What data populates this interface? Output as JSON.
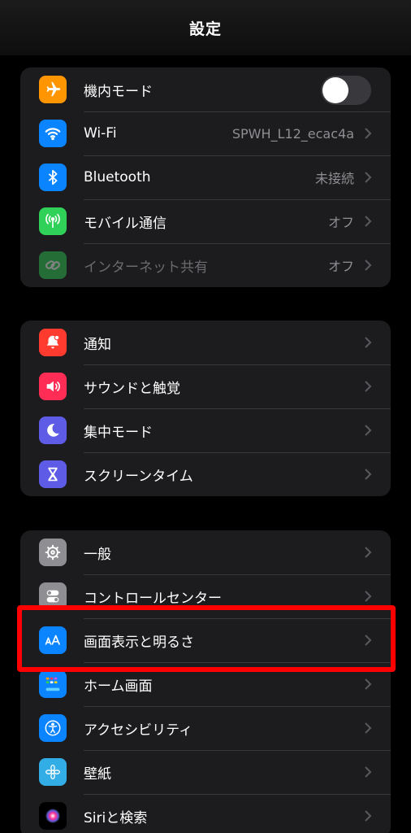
{
  "nav": {
    "title": "設定"
  },
  "groups": [
    {
      "items": [
        {
          "label": "機内モード",
          "icon": "airplane-icon",
          "color": "#ff9500",
          "toggle": false
        },
        {
          "label": "Wi-Fi",
          "value": "SPWH_L12_ecac4a",
          "icon": "wifi-icon",
          "color": "#0a84ff"
        },
        {
          "label": "Bluetooth",
          "value": "未接続",
          "icon": "bluetooth-icon",
          "color": "#0a84ff"
        },
        {
          "label": "モバイル通信",
          "value": "オフ",
          "icon": "antenna-icon",
          "color": "#30d158"
        },
        {
          "label": "インターネット共有",
          "value": "オフ",
          "icon": "link-chain-icon",
          "color": "#30d158"
        }
      ]
    },
    {
      "items": [
        {
          "label": "通知",
          "icon": "bell-icon",
          "color": "#ff3b30"
        },
        {
          "label": "サウンドと触覚",
          "icon": "speaker-icon",
          "color": "#ff2d55"
        },
        {
          "label": "集中モード",
          "icon": "moon-icon",
          "color": "#5e5ce6"
        },
        {
          "label": "スクリーンタイム",
          "icon": "hourglass-icon",
          "color": "#5e5ce6"
        }
      ]
    },
    {
      "items": [
        {
          "label": "一般",
          "icon": "gear-icon",
          "color": "#8e8e93"
        },
        {
          "label": "コントロールセンター",
          "icon": "switches-icon",
          "color": "#8e8e93"
        },
        {
          "label": "画面表示と明るさ",
          "icon": "text-size-icon",
          "color": "#0a84ff"
        },
        {
          "label": "ホーム画面",
          "icon": "home-grid-icon",
          "color": "#0a84ff"
        },
        {
          "label": "アクセシビリティ",
          "icon": "accessibility-icon",
          "color": "#0a84ff"
        },
        {
          "label": "壁紙",
          "icon": "flower-icon",
          "color": "#32ade6"
        },
        {
          "label": "Siriと検索",
          "icon": "siri-icon",
          "color": "#000000"
        }
      ]
    }
  ],
  "highlight_color": "#ff0000"
}
